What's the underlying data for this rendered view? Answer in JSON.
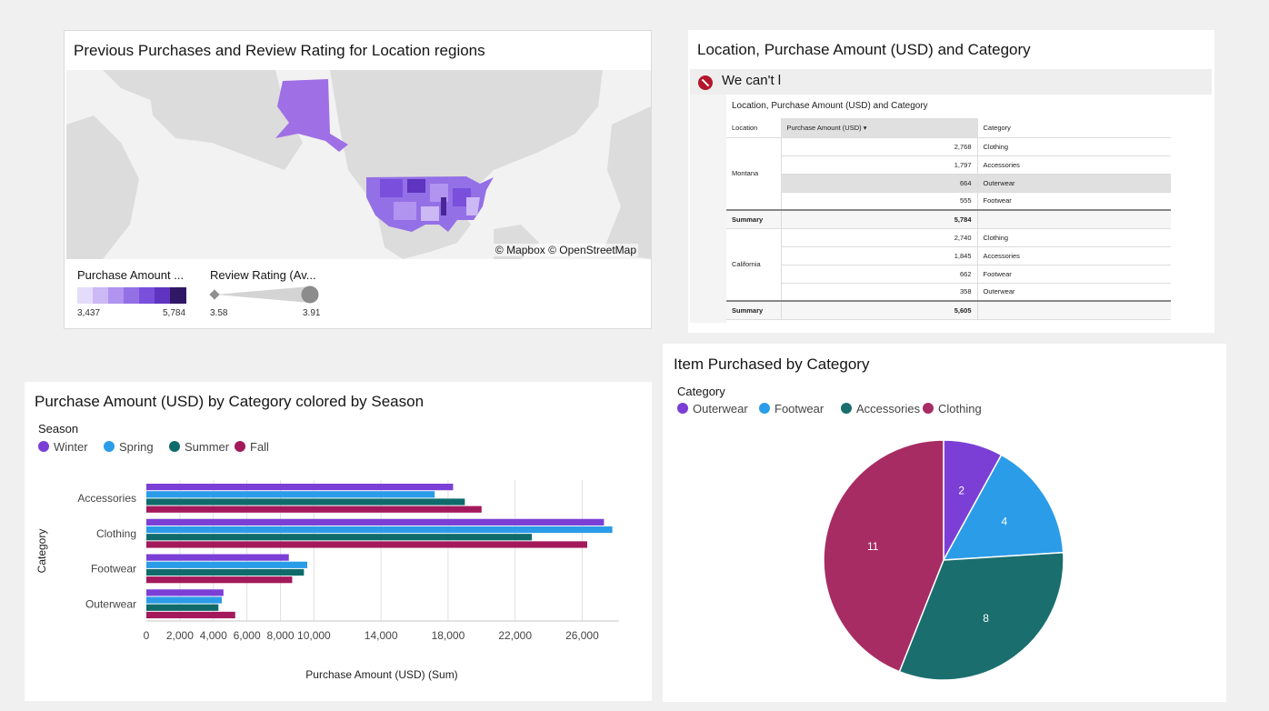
{
  "map_panel": {
    "title": "Previous Purchases and Review Rating for Location regions",
    "attribution": "© Mapbox © OpenStreetMap",
    "color_legend": {
      "title": "Purchase Amount ...",
      "min": "3,437",
      "max": "5,784",
      "colors": [
        "#e4dcfa",
        "#cbb8f5",
        "#b094ef",
        "#9470e6",
        "#7a4fdc",
        "#5f34c0",
        "#4a2599",
        "#311866"
      ]
    },
    "size_legend": {
      "title": "Review Rating (Av...",
      "min": "3.58",
      "max": "3.91"
    }
  },
  "table_panel": {
    "title": "Location, Purchase Amount (USD) and Category",
    "warning": "We can't l",
    "inner_title": "Location, Purchase Amount (USD) and Category",
    "headers": {
      "location": "Location",
      "amount": "Purchase Amount (USD) ▾",
      "category": "Category"
    },
    "groups": [
      {
        "location": "Montana",
        "rows": [
          {
            "amount": "2,768",
            "category": "Clothing"
          },
          {
            "amount": "1,797",
            "category": "Accessories"
          },
          {
            "amount": "664",
            "category": "Outerwear"
          },
          {
            "amount": "555",
            "category": "Footwear"
          }
        ],
        "summary_label": "Summary",
        "summary_value": "5,784"
      },
      {
        "location": "California",
        "rows": [
          {
            "amount": "2,740",
            "category": "Clothing"
          },
          {
            "amount": "1,845",
            "category": "Accessories"
          },
          {
            "amount": "662",
            "category": "Footwear"
          },
          {
            "amount": "358",
            "category": "Outerwear"
          }
        ],
        "summary_label": "Summary",
        "summary_value": "5,605"
      }
    ]
  },
  "bar_panel": {
    "title": "Purchase Amount (USD) by Category colored by Season",
    "legend_title": "Season",
    "colors": {
      "Winter": "#7b3fd6",
      "Spring": "#2b9ce8",
      "Summer": "#0f6b6b",
      "Fall": "#a3195b"
    }
  },
  "pie_panel": {
    "title": "Item Purchased by Category",
    "legend_title": "Category",
    "colors": {
      "Outerwear": "#7b3fd6",
      "Footwear": "#2b9ce8",
      "Accessories": "#1a6e6e",
      "Clothing": "#a72c63"
    }
  },
  "chart_data": [
    {
      "type": "bar",
      "orientation": "horizontal",
      "title": "Purchase Amount (USD) by Category colored by Season",
      "xlabel": "Purchase Amount (USD) (Sum)",
      "ylabel": "Category",
      "categories": [
        "Accessories",
        "Clothing",
        "Footwear",
        "Outerwear"
      ],
      "series": [
        {
          "name": "Winter",
          "values": [
            18300,
            27300,
            8500,
            4600
          ]
        },
        {
          "name": "Spring",
          "values": [
            17200,
            27800,
            9600,
            4500
          ]
        },
        {
          "name": "Summer",
          "values": [
            19000,
            23000,
            9400,
            4300
          ]
        },
        {
          "name": "Fall",
          "values": [
            20000,
            26300,
            8700,
            5300
          ]
        }
      ],
      "xticks": [
        "0",
        "2,000",
        "4,000",
        "6,000",
        "8,000",
        "10,000",
        "14,000",
        "18,000",
        "22,000",
        "26,000"
      ],
      "xlim": [
        0,
        28200
      ],
      "grid": true,
      "legend": "top-left"
    },
    {
      "type": "pie",
      "title": "Item Purchased by Category",
      "labels": [
        "Outerwear",
        "Footwear",
        "Accessories",
        "Clothing"
      ],
      "values": [
        2,
        4,
        8,
        11
      ],
      "legend": "top-left"
    }
  ]
}
